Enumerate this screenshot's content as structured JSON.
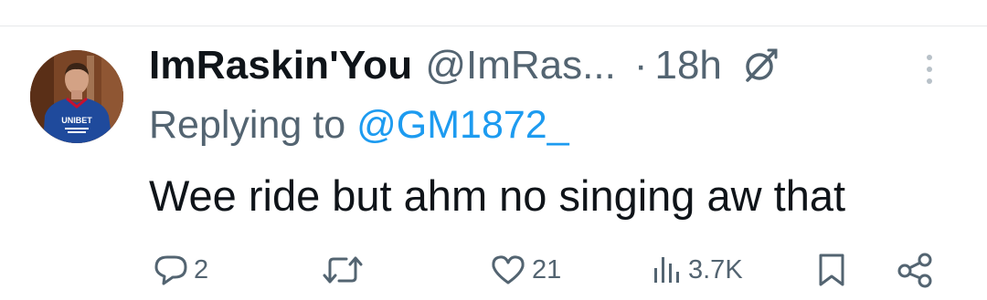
{
  "tweet": {
    "display_name": "ImRaskin'You",
    "handle": "@ImRas...",
    "separator": "·",
    "time": "18h",
    "replying_prefix": "Replying to",
    "replying_handle": "@GM1872_",
    "text": "Wee ride but ahm no singing aw that"
  },
  "actions": {
    "replies": "2",
    "retweets": "",
    "likes": "21",
    "views": "3.7K"
  },
  "avatar": {
    "shirt_text": "UNIBET"
  },
  "icons": {
    "reply": "comment-icon",
    "retweet": "retweet-icon",
    "like": "heart-icon",
    "views": "views-icon",
    "bookmark": "bookmark-icon",
    "share": "share-icon",
    "grok": "grok-icon",
    "more": "more-vertical-icon"
  },
  "colors": {
    "link": "#1d9bf0",
    "muted": "#536471",
    "text": "#0f1419"
  }
}
